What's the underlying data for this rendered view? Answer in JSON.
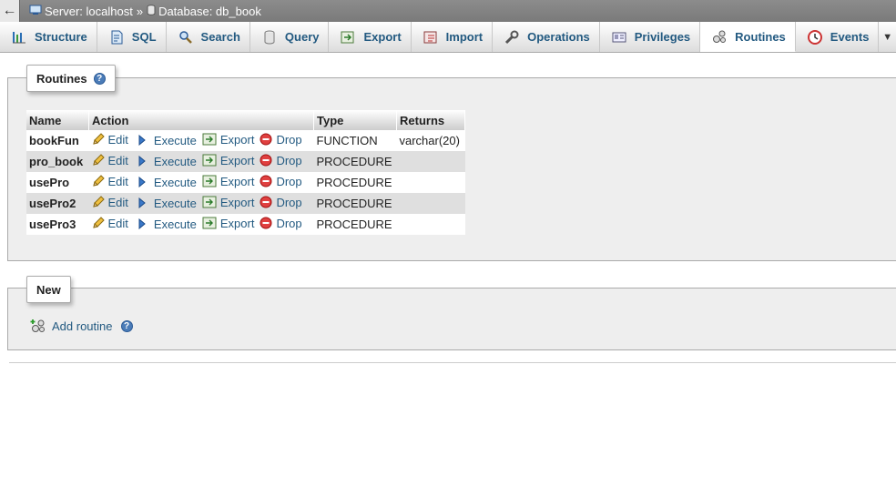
{
  "breadcrumb": {
    "back_glyph": "←",
    "server_label": "Server: localhost",
    "separator": "»",
    "database_label": "Database: db_book"
  },
  "tabs": [
    {
      "label": "Structure",
      "icon": "structure-icon"
    },
    {
      "label": "SQL",
      "icon": "sql-icon"
    },
    {
      "label": "Search",
      "icon": "search-icon"
    },
    {
      "label": "Query",
      "icon": "query-icon"
    },
    {
      "label": "Export",
      "icon": "export-icon"
    },
    {
      "label": "Import",
      "icon": "import-icon"
    },
    {
      "label": "Operations",
      "icon": "wrench-icon"
    },
    {
      "label": "Privileges",
      "icon": "privileges-icon"
    },
    {
      "label": "Routines",
      "icon": "routines-icon",
      "active": true
    },
    {
      "label": "Events",
      "icon": "events-clock-icon"
    }
  ],
  "more_glyph": "▼",
  "routines_section": {
    "title": "Routines",
    "help_glyph": "?",
    "columns": [
      "Name",
      "Action",
      "Type",
      "Returns"
    ],
    "actions": {
      "edit": "Edit",
      "execute": "Execute",
      "export": "Export",
      "drop": "Drop"
    },
    "rows": [
      {
        "name": "bookFun",
        "type": "FUNCTION",
        "returns": "varchar(20)"
      },
      {
        "name": "pro_book",
        "type": "PROCEDURE",
        "returns": ""
      },
      {
        "name": "usePro",
        "type": "PROCEDURE",
        "returns": ""
      },
      {
        "name": "usePro2",
        "type": "PROCEDURE",
        "returns": ""
      },
      {
        "name": "usePro3",
        "type": "PROCEDURE",
        "returns": ""
      }
    ]
  },
  "new_section": {
    "title": "New",
    "add_routine": "Add routine",
    "help_glyph": "?"
  },
  "colors": {
    "link": "#235a81",
    "topbar": "#808080",
    "row_alt": "#dfdfdf",
    "panel": "#eeeeee"
  }
}
